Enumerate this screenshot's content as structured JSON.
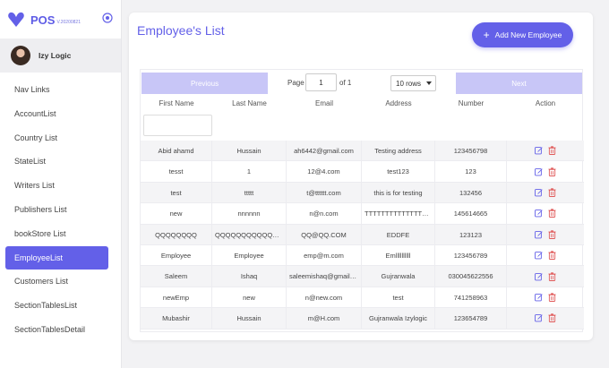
{
  "brand": {
    "name": "POS",
    "version": "V.20200821",
    "logo_color": "#6360e8"
  },
  "user": {
    "name": "Izy Logic"
  },
  "nav": {
    "items": [
      {
        "label": "Nav Links",
        "active": false
      },
      {
        "label": "AccountList",
        "active": false
      },
      {
        "label": "Country List",
        "active": false
      },
      {
        "label": "StateList",
        "active": false
      },
      {
        "label": "Writers List",
        "active": false
      },
      {
        "label": "Publishers List",
        "active": false
      },
      {
        "label": "bookStore List",
        "active": false
      },
      {
        "label": "EmployeeList",
        "active": true
      },
      {
        "label": "Customers List",
        "active": false
      },
      {
        "label": "SectionTablesList",
        "active": false
      },
      {
        "label": "SectionTablesDetail",
        "active": false
      }
    ]
  },
  "page": {
    "title": "Employee's List",
    "add_button_label": "Add New Employee",
    "add_icon": "+"
  },
  "pager": {
    "previous_label": "Previous",
    "next_label": "Next",
    "page_label": "Page",
    "page_value": "1",
    "of_label": "of 1",
    "rows_value": "10 rows"
  },
  "table": {
    "columns": [
      "First Name",
      "Last Name",
      "Email",
      "Address",
      "Number",
      "Action"
    ],
    "rows": [
      [
        "Abid ahamd",
        "Hussain",
        "ah6442@gmail.com",
        "Testing address",
        "123456798"
      ],
      [
        "tesst",
        "1",
        "12@4.com",
        "test123",
        "123"
      ],
      [
        "test",
        "ttttt",
        "t@tttttt.com",
        "this is for testing",
        "132456"
      ],
      [
        "new",
        "nnnnnn",
        "n@n.com",
        "TTTTTTTTTTTTTTTTTTTTTTTT",
        "145614665"
      ],
      [
        "QQQQQQQQ",
        "QQQQQQQQQQQQQQQQQ",
        "QQ@QQ.COM",
        "EDDFE",
        "123123"
      ],
      [
        "Employee",
        "Employee",
        "emp@m.com",
        "Emllllllllll",
        "123456789"
      ],
      [
        "Saleem",
        "Ishaq",
        "saleemishaq@gmail.com",
        "Gujranwala",
        "030045622556"
      ],
      [
        "newEmp",
        "new",
        "n@new.com",
        "test",
        "741258963"
      ],
      [
        "Mubashir",
        "Hussain",
        "m@H.com",
        "Gujranwala Izylogic",
        "123654789"
      ]
    ]
  },
  "colors": {
    "accent": "#6360e8",
    "edit_icon": "#6360e8",
    "delete_icon": "#e05a5a"
  }
}
